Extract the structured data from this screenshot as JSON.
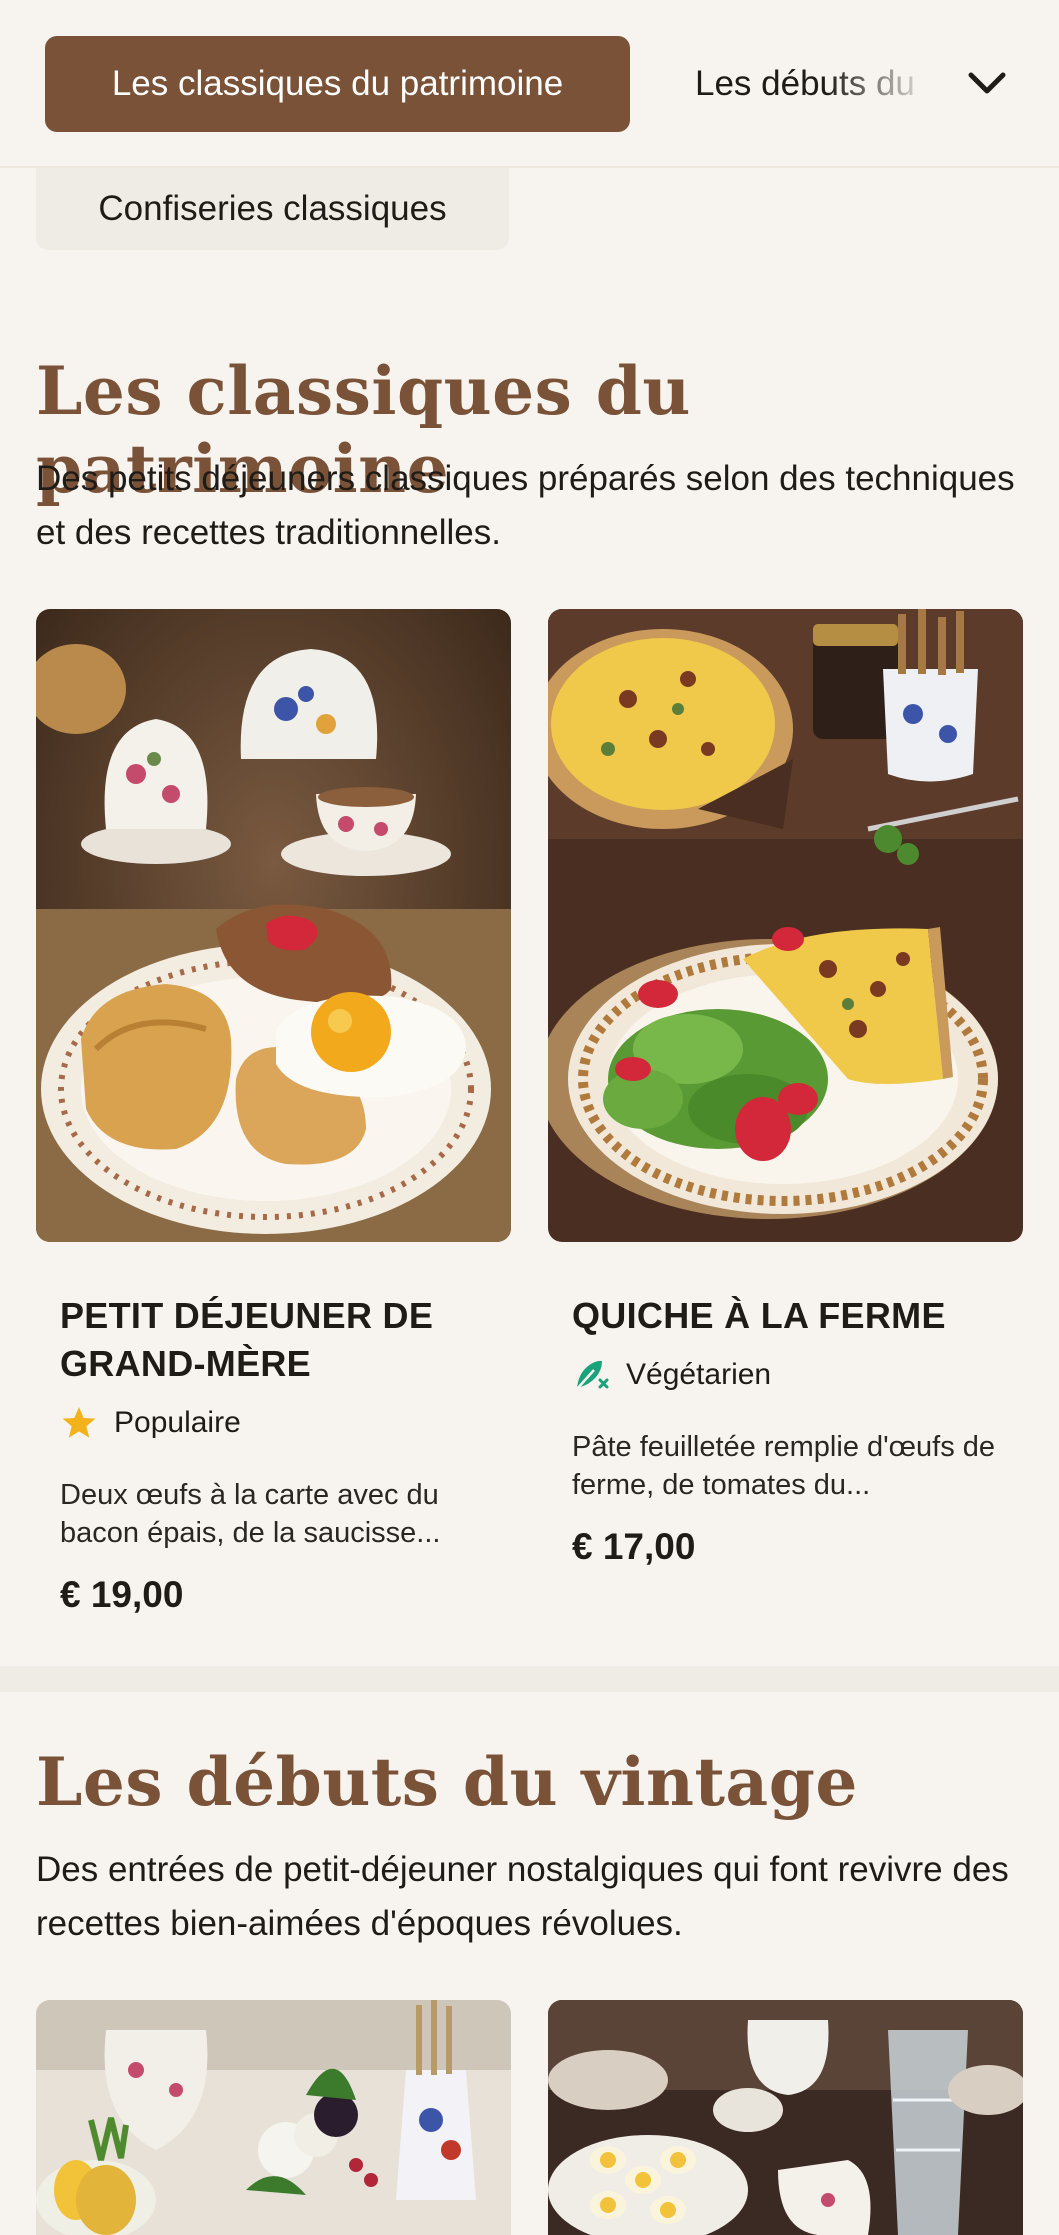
{
  "nav": {
    "active_category": "Les classiques du patrimoine",
    "next_category": "Les débuts du",
    "secondary_category": "Confiseries classiques",
    "expand_icon": "chevron-down-icon"
  },
  "sections": [
    {
      "title": "Les classiques du patrimoine",
      "description": "Des petits déjeuners classiques préparés selon des techniques et des recettes traditionnelles.",
      "items": [
        {
          "name": "PETIT DÉJEUNER DE GRAND-MÈRE",
          "tag": "Populaire",
          "tag_icon": "star-icon",
          "description": "Deux œufs à la carte avec du bacon épais, de la saucisse...",
          "price": "€ 19,00"
        },
        {
          "name": "QUICHE À LA FERME",
          "tag": "Végétarien",
          "tag_icon": "vegetarian-leaf-icon",
          "description": "Pâte feuilletée remplie d'œufs de ferme, de tomates du...",
          "price": "€ 17,00"
        }
      ]
    },
    {
      "title": "Les débuts du vintage",
      "description": "Des entrées de petit-déjeuner nostalgiques qui font revivre des recettes bien-aimées d'époques révolues."
    }
  ],
  "colors": {
    "accent": "#7a5238",
    "background": "#f7f4ef",
    "star": "#f3b21b",
    "vegetarian": "#1aa37a"
  }
}
